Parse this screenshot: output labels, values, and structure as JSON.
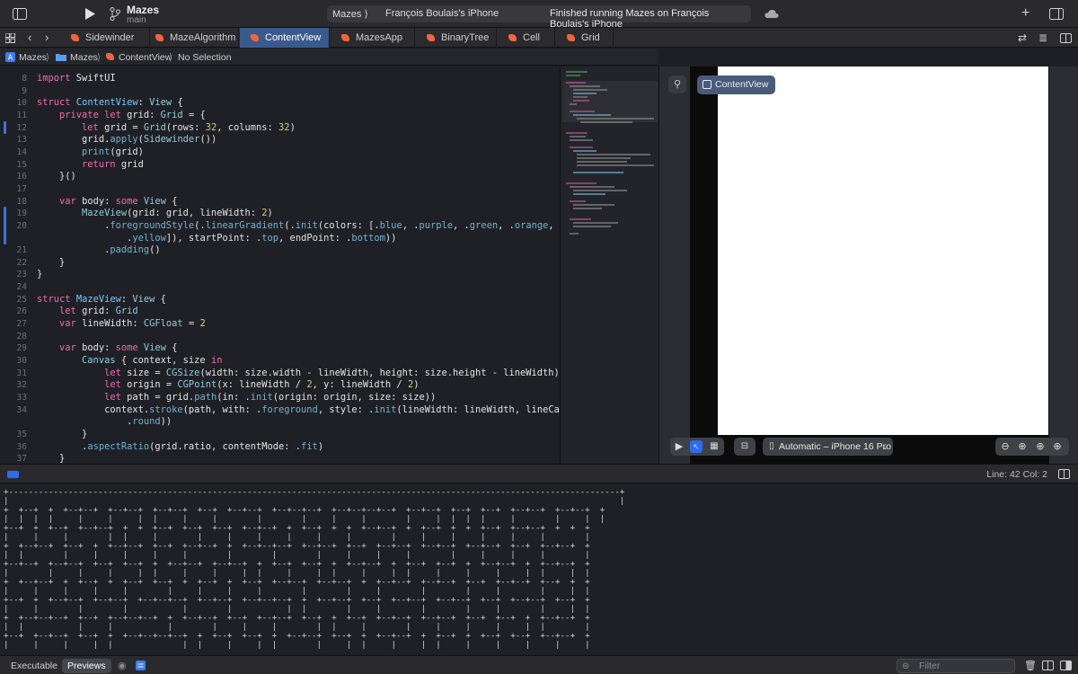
{
  "toolbar": {
    "project_name": "Mazes",
    "branch": "main",
    "scheme_app": "Mazes ⟩",
    "scheme_device": "François Boulais's iPhone",
    "status": "Finished running Mazes on François Boulais's iPhone"
  },
  "tabs": [
    {
      "label": "Sidewinder",
      "active": false
    },
    {
      "label": "MazeAlgorithm",
      "active": false
    },
    {
      "label": "ContentView",
      "active": true
    },
    {
      "label": "MazesApp",
      "active": false
    },
    {
      "label": "BinaryTree",
      "active": false
    },
    {
      "label": "Cell",
      "active": false
    },
    {
      "label": "Grid",
      "active": false
    }
  ],
  "breadcrumb": {
    "project": "Mazes",
    "folder": "Mazes",
    "file": "ContentView",
    "selection": "No Selection",
    "sep": "⟩"
  },
  "editor": {
    "line_numbers": [
      "8",
      "9",
      "10",
      "11",
      "12",
      "13",
      "14",
      "15",
      "16",
      "17",
      "18",
      "19",
      "20",
      "",
      "21",
      "22",
      "23",
      "24",
      "25",
      "26",
      "27",
      "28",
      "29",
      "30",
      "31",
      "32",
      "33",
      "34",
      "",
      "35",
      "36",
      "37"
    ]
  },
  "preview": {
    "pill_label": "ContentView",
    "device": "Automatic – iPhone 16 Pro",
    "gradient_colors": [
      "#3b6cf5",
      "#a349d6",
      "#5cbf4a",
      "#f0a52e",
      "#f5d530"
    ],
    "maze_rows": 32,
    "maze_columns": 32
  },
  "debug": {
    "line_col": "Line: 42  Col: 2"
  },
  "console": {
    "maze_lines": [
      "+---------------------------------------------------------------------------------------------------------------------------+",
      "|                                                                                                                           |",
      "+  +--+  +  +--+--+  +--+--+  +--+--+  +--+  +--+--+  +--+--+--+  +--+--+--+--+  +--+--+  +--+  +--+  +--+--+  +--+--+  +",
      "|  |  |  |     |     |     |  |     |     |        |        |     |     |        |     |  |  |  |     |        |     |  |",
      "+--+  +  +--+  +--+--+  +  +  +--+  +--+  +--+  +--+--+  +  +--+  +  +  +--+--+  +  +--+  +  +  +--+  +--+--+  +  +  +",
      "|     |     |        |  |     |        |     |     |     |     |     |        |     |     |     |     |     |        |",
      "+  +--+--+  +--+  +  +--+--+  +--+  +--+--+  +  +--+--+--+  +--+--+  +--+  +--+--+  +--+--+  +--+--+  +--+  +--+--+  +",
      "|  |        |     |     |     |     |        |        |        |     |     |     |        |     |     |     |        |",
      "+--+--+  +--+--+  +--+  +--+  +  +--+--+  +--+--+  +  +--+  +--+  +  +--+--+  +  +--+  +--+  +  +--+--+  +  +--+--+  +",
      "|        |     |     |     |  |     |     |     |  |     |     |  |     |     |  |     |     |     |     |  |     |  |",
      "+  +--+--+  +  +--+  +  +--+  +--+  +  +--+  +  +--+  +--+--+  +--+--+  +  +--+--+  +--+--+  +--+  +--+--+  +--+  +  +",
      "|     |     |     |     |        |     |     |     |        |        |     |        |        |     |        |     |  |",
      "+--+  +  +--+--+  +--+--+  +--+--+--+  +--+--+  +--+--+--+  +  +--+--+  +--+  +--+--+  +--+--+  +--+  +--+--+  +--+  +",
      "|     |        |        |           |        |           |  |        |     |        |        |     |        |     |  |",
      "+  +--+--+--+  +--+  +--+--+--+  +  +--+--+  +--+  +--+--+  +--+  +  +--+  +--+--+  +--+--+  +--+  +--+  +  +--+--+  +",
      "|  |           |     |           |        |     |     |        |  |     |        |     |     |     |     |  |        |",
      "+--+  +--+--+  +--+  +  +--+--+--+--+  +  +--+  +--+  +  +--+--+  +--+  +  +--+--+  +  +--+  +  +--+  +--+  +--+--+  +",
      "|     |     |     |  |              |  |     |     |  |        |     |  |     |     |  |     |     |     |     |     |"
    ]
  },
  "bottombar": {
    "executable": "Executable",
    "previews": "Previews",
    "filter_placeholder": "Filter"
  }
}
